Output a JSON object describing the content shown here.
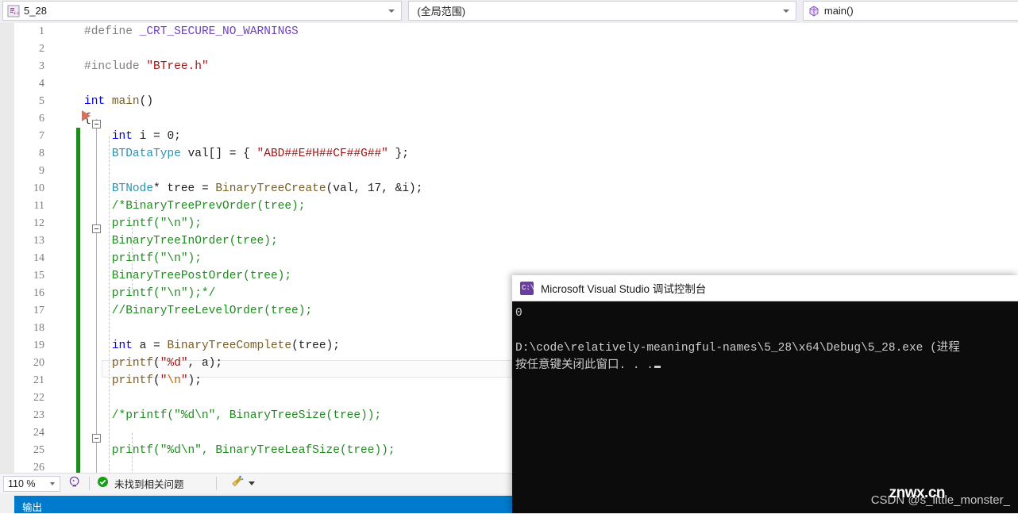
{
  "navbar": {
    "document_combo": {
      "icon": "cpp-file-icon",
      "value": "5_28"
    },
    "scope_combo": {
      "value": "(全局范围)"
    },
    "member_combo": {
      "icon": "method-cube-icon",
      "value": "main()"
    }
  },
  "editor": {
    "lines": [
      {
        "no": "1",
        "tokens": [
          {
            "t": "#define ",
            "c": "t-pre"
          },
          {
            "t": "_CRT_SECURE_NO_WARNINGS",
            "c": "t-macro"
          }
        ]
      },
      {
        "no": "2",
        "tokens": []
      },
      {
        "no": "3",
        "tokens": [
          {
            "t": "#include ",
            "c": "t-pre"
          },
          {
            "t": "\"BTree.h\"",
            "c": "t-str"
          }
        ]
      },
      {
        "no": "4",
        "tokens": []
      },
      {
        "no": "5",
        "tokens": [
          {
            "t": "int",
            "c": "t-kw"
          },
          {
            "t": " ",
            "c": "t-plain"
          },
          {
            "t": "main",
            "c": "t-fn"
          },
          {
            "t": "()",
            "c": "t-plain"
          }
        ]
      },
      {
        "no": "6",
        "tokens": [
          {
            "t": "{",
            "c": "t-plain"
          }
        ]
      },
      {
        "no": "7",
        "tokens": [
          {
            "t": "    ",
            "c": "t-plain"
          },
          {
            "t": "int",
            "c": "t-kw"
          },
          {
            "t": " i = ",
            "c": "t-plain"
          },
          {
            "t": "0",
            "c": "t-num"
          },
          {
            "t": ";",
            "c": "t-plain"
          }
        ]
      },
      {
        "no": "8",
        "tokens": [
          {
            "t": "    ",
            "c": "t-plain"
          },
          {
            "t": "BTDataType",
            "c": "t-type"
          },
          {
            "t": " val[] = { ",
            "c": "t-plain"
          },
          {
            "t": "\"ABD##E#H##CF##G##\"",
            "c": "t-str"
          },
          {
            "t": " };",
            "c": "t-plain"
          }
        ]
      },
      {
        "no": "9",
        "tokens": []
      },
      {
        "no": "10",
        "tokens": [
          {
            "t": "    ",
            "c": "t-plain"
          },
          {
            "t": "BTNode",
            "c": "t-type"
          },
          {
            "t": "* tree = ",
            "c": "t-plain"
          },
          {
            "t": "BinaryTreeCreate",
            "c": "t-fn"
          },
          {
            "t": "(",
            "c": "t-plain"
          },
          {
            "t": "val",
            "c": "t-plain"
          },
          {
            "t": ", ",
            "c": "t-plain"
          },
          {
            "t": "17",
            "c": "t-num"
          },
          {
            "t": ", &i);",
            "c": "t-plain"
          }
        ]
      },
      {
        "no": "11",
        "tokens": [
          {
            "t": "    /*BinaryTreePrevOrder(tree);",
            "c": "t-cmt"
          }
        ]
      },
      {
        "no": "12",
        "tokens": [
          {
            "t": "    printf(\"\\n\");",
            "c": "t-cmt"
          }
        ]
      },
      {
        "no": "13",
        "tokens": [
          {
            "t": "    BinaryTreeInOrder(tree);",
            "c": "t-cmt"
          }
        ]
      },
      {
        "no": "14",
        "tokens": [
          {
            "t": "    printf(\"\\n\");",
            "c": "t-cmt"
          }
        ]
      },
      {
        "no": "15",
        "tokens": [
          {
            "t": "    BinaryTreePostOrder(tree);",
            "c": "t-cmt"
          }
        ]
      },
      {
        "no": "16",
        "tokens": [
          {
            "t": "    printf(\"\\n\");*/",
            "c": "t-cmt"
          }
        ]
      },
      {
        "no": "17",
        "tokens": [
          {
            "t": "    //BinaryTreeLevelOrder(tree);",
            "c": "t-cmt"
          }
        ]
      },
      {
        "no": "18",
        "tokens": []
      },
      {
        "no": "19",
        "tokens": [
          {
            "t": "    ",
            "c": "t-plain"
          },
          {
            "t": "int",
            "c": "t-kw"
          },
          {
            "t": " a = ",
            "c": "t-plain"
          },
          {
            "t": "BinaryTreeComplete",
            "c": "t-fn"
          },
          {
            "t": "(tree);",
            "c": "t-plain"
          }
        ]
      },
      {
        "no": "20",
        "tokens": [
          {
            "t": "    ",
            "c": "t-plain"
          },
          {
            "t": "printf",
            "c": "t-fn"
          },
          {
            "t": "(",
            "c": "t-plain"
          },
          {
            "t": "\"%d\"",
            "c": "t-str"
          },
          {
            "t": ", a);",
            "c": "t-plain"
          }
        ]
      },
      {
        "no": "21",
        "tokens": [
          {
            "t": "    ",
            "c": "t-plain"
          },
          {
            "t": "printf",
            "c": "t-fn"
          },
          {
            "t": "(",
            "c": "t-plain"
          },
          {
            "t": "\"",
            "c": "t-str"
          },
          {
            "t": "\\n",
            "c": "t-esc"
          },
          {
            "t": "\"",
            "c": "t-str"
          },
          {
            "t": ");",
            "c": "t-plain"
          }
        ]
      },
      {
        "no": "22",
        "tokens": []
      },
      {
        "no": "23",
        "tokens": [
          {
            "t": "    /*printf(\"%d\\n\", BinaryTreeSize(tree));",
            "c": "t-cmt"
          }
        ]
      },
      {
        "no": "24",
        "tokens": []
      },
      {
        "no": "25",
        "tokens": [
          {
            "t": "    printf(\"%d\\n\", BinaryTreeLeafSize(tree));",
            "c": "t-cmt"
          }
        ]
      },
      {
        "no": "26",
        "tokens": []
      }
    ]
  },
  "status_bar": {
    "zoom": "110 %",
    "lightbulb_icon": "quick-actions-icon",
    "health_icon": "status-ok-icon",
    "health_text": "未找到相关问题",
    "broom_icon": "code-cleanup-icon"
  },
  "output_panel": {
    "tab_label": "输出"
  },
  "console": {
    "icon": "console-app-icon",
    "title": "Microsoft Visual Studio 调试控制台",
    "lines": [
      "0",
      "",
      "D:\\code\\relatively-meaningful-names\\5_28\\x64\\Debug\\5_28.exe (进程",
      "按任意键关闭此窗口. . ."
    ]
  },
  "watermark": {
    "text": "CSDN @s_little_monster_",
    "overlay": "znwx.cn"
  },
  "colors": {
    "accent_blue": "#007acc",
    "change_bar_green": "#1f8b1f",
    "console_bg": "#0c0c0c",
    "comment_green": "#1f8b1f",
    "string_red": "#a31515",
    "keyword_blue": "#0000ff",
    "type_teal": "#2b91af",
    "macro_purple": "#6f42c1",
    "run_arrow": "#d9705e"
  }
}
